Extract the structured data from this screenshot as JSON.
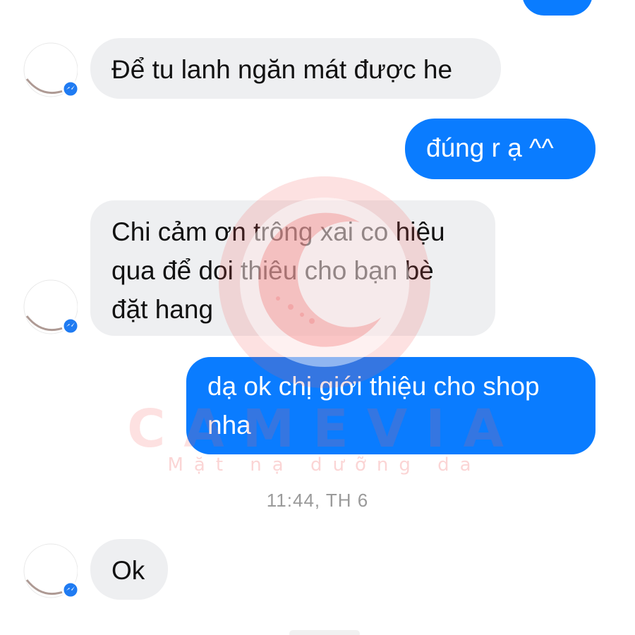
{
  "conversation": {
    "messages": [
      {
        "sender": "other",
        "text": "Để tu lanh ngăn mát được he"
      },
      {
        "sender": "me",
        "text": "đúng r ạ ^^"
      },
      {
        "sender": "other",
        "text": "Chi cảm ơn trông xai co hiệu\nqua để doi thiêu cho bạn bè\nđặt hang"
      },
      {
        "sender": "me",
        "text": "dạ ok chị giới thiệu cho shop\nnha"
      },
      {
        "sender": "other",
        "text": "Ok"
      }
    ],
    "timestamp": "11:44, TH 6"
  },
  "watermark": {
    "brand": "CAMEVIA",
    "tagline": "Mặt nạ dưỡng da"
  },
  "colors": {
    "outgoing_bubble": "#0a7cff",
    "incoming_bubble": "#eeeff1",
    "watermark": "#f05a5a",
    "messenger_badge": "#1f7bf2"
  },
  "icons": {
    "avatar": "avatar-icon",
    "badge": "messenger-badge-icon"
  }
}
